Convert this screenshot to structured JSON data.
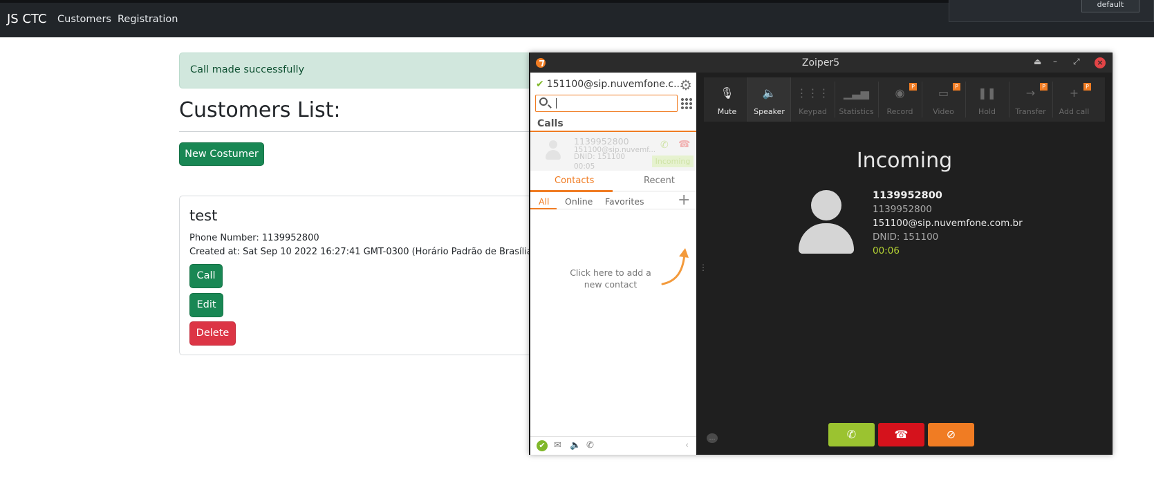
{
  "navbar": {
    "brand": "JS CTC",
    "links": [
      "Customers",
      "Registration"
    ],
    "profile_button": "default"
  },
  "alert": {
    "text": "Call made successfully"
  },
  "page": {
    "title": "Customers List:",
    "new_button": "New Costumer"
  },
  "customer": {
    "name": "test",
    "phone_line": "Phone Number: 1139952800",
    "created_line": "Created at: Sat Sep 10 2022 16:27:41 GMT-0300 (Horário Padrão de Brasília)",
    "buttons": {
      "call": "Call",
      "edit": "Edit",
      "delete": "Delete"
    }
  },
  "zoiper": {
    "window_title": "Zoiper5",
    "account": "151100@sip.nuvemfone.c...",
    "calls_header": "Calls",
    "call_item": {
      "number": "1139952800",
      "sip": "151100@sip.nuvemf...",
      "dnid": "DNID: 151100",
      "time": "00:05",
      "status": "Incoming"
    },
    "tabs": [
      "Contacts",
      "Recent"
    ],
    "filters": [
      "All",
      "Online",
      "Favorites"
    ],
    "add_contact_hint_1": "Click here to add a",
    "add_contact_hint_2": "new contact",
    "toolbar": [
      {
        "label": "Mute",
        "icon": "mic-off-icon"
      },
      {
        "label": "Speaker",
        "icon": "speaker-icon"
      },
      {
        "label": "Keypad",
        "icon": "keypad-icon"
      },
      {
        "label": "Statistics",
        "icon": "stats-icon"
      },
      {
        "label": "Record",
        "icon": "record-icon",
        "badge": "P"
      },
      {
        "label": "Video",
        "icon": "video-icon",
        "badge": "P"
      },
      {
        "label": "Hold",
        "icon": "pause-icon"
      },
      {
        "label": "Transfer",
        "icon": "transfer-icon",
        "badge": "P"
      },
      {
        "label": "Add call",
        "icon": "plus-icon",
        "badge": "P"
      }
    ],
    "incoming_title": "Incoming",
    "caller": {
      "number": "1139952800",
      "number2": "1139952800",
      "sip": "151100@sip.nuvemfone.com.br",
      "dnid": "DNID: 151100",
      "timer": "00:06"
    },
    "colors": {
      "accent": "#f07c23",
      "answer": "#9bc330",
      "hangup": "#d5121c"
    }
  }
}
